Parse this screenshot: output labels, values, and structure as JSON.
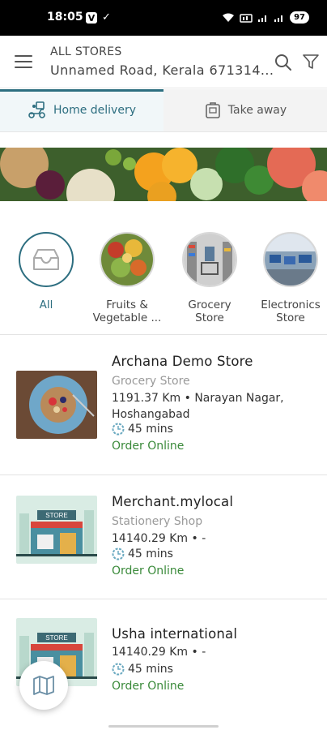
{
  "status_bar": {
    "time": "18:05",
    "notif_v": "V",
    "battery": "97"
  },
  "header": {
    "label": "ALL STORES",
    "address": "Unnamed Road, Kerala 671314..."
  },
  "tabs": [
    {
      "label": "Home delivery",
      "icon": "scooter-icon",
      "active": true
    },
    {
      "label": "Take away",
      "icon": "bag-icon",
      "active": false
    }
  ],
  "categories": [
    {
      "label": "All",
      "icon": "inbox-icon"
    },
    {
      "label": "Fruits & Vegetable ...",
      "icon": "vegetables-image"
    },
    {
      "label": "Grocery Store",
      "icon": "grocery-store-image"
    },
    {
      "label": "Electronics Store",
      "icon": "electronics-store-image"
    }
  ],
  "stores": [
    {
      "name": "Archana Demo Store",
      "category": "Grocery Store",
      "distance": "1191.37 Km • Narayan Nagar, Hoshangabad",
      "time": "45 mins",
      "order": "Order Online"
    },
    {
      "name": "Merchant.mylocal",
      "category": "Stationery Shop",
      "distance": "14140.29 Km • -",
      "time": "45 mins",
      "order": "Order Online"
    },
    {
      "name": "Usha international",
      "distance": "14140.29 Km • -",
      "time": "45 mins",
      "order": "Order Online"
    }
  ],
  "thumb_sign": "STORE",
  "colors": {
    "accent": "#2d6e80",
    "order_green": "#3a8a3a",
    "category_gray": "#9a9a9a"
  }
}
